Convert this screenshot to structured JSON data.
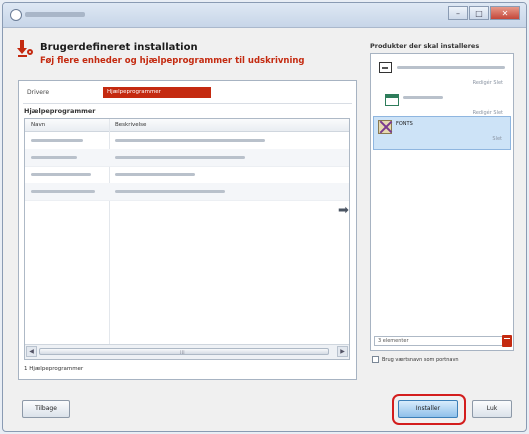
{
  "header": {
    "title": "Brugerdefineret installation",
    "subtitle": "Føj flere enheder og hjælpeprogrammer til udskrivning"
  },
  "drivers": {
    "label": "Drivere",
    "value": "Hjælpeprogrammer"
  },
  "utilities": {
    "label": "Hjælpeprogrammer",
    "columns": [
      "Navn",
      "Beskrivelse"
    ],
    "footer": "1 Hjælpeprogrammer"
  },
  "products": {
    "title": "Produkter der skal installeres",
    "items": [
      {
        "name": "",
        "status": "Redigér  Slet",
        "icon": "printer-icon"
      },
      {
        "name": "",
        "status": "Redigér  Slet",
        "icon": "window-icon"
      },
      {
        "name": "FONTS",
        "status": "Slet",
        "icon": "fonts-icon"
      }
    ],
    "selection_text": "3 elementer",
    "checkbox_label": "Brug værtsnavn som portnavn"
  },
  "buttons": {
    "back": "Tilbage",
    "install": "Installer",
    "close": "Luk"
  }
}
